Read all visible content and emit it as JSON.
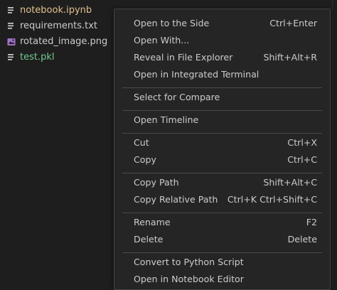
{
  "explorer": {
    "files": [
      {
        "name": "notebook.ipynb",
        "color": "#e2c08d",
        "icon": "notebook-icon",
        "icon_color": "#d4d4d4"
      },
      {
        "name": "requirements.txt",
        "color": "#cccccc",
        "icon": "text-file-icon",
        "icon_color": "#d4d4d4"
      },
      {
        "name": "rotated_image.png",
        "color": "#cccccc",
        "icon": "image-file-icon",
        "icon_color": "#a074c4"
      },
      {
        "name": "test.pkl",
        "color": "#73c991",
        "icon": "file-lines-icon",
        "icon_color": "#d4d4d4"
      }
    ]
  },
  "context_menu": {
    "groups": [
      [
        {
          "label": "Open to the Side",
          "shortcut": "Ctrl+Enter"
        },
        {
          "label": "Open With...",
          "shortcut": ""
        },
        {
          "label": "Reveal in File Explorer",
          "shortcut": "Shift+Alt+R"
        },
        {
          "label": "Open in Integrated Terminal",
          "shortcut": ""
        }
      ],
      [
        {
          "label": "Select for Compare",
          "shortcut": ""
        }
      ],
      [
        {
          "label": "Open Timeline",
          "shortcut": ""
        }
      ],
      [
        {
          "label": "Cut",
          "shortcut": "Ctrl+X"
        },
        {
          "label": "Copy",
          "shortcut": "Ctrl+C"
        }
      ],
      [
        {
          "label": "Copy Path",
          "shortcut": "Shift+Alt+C"
        },
        {
          "label": "Copy Relative Path",
          "shortcut": "Ctrl+K Ctrl+Shift+C"
        }
      ],
      [
        {
          "label": "Rename",
          "shortcut": "F2"
        },
        {
          "label": "Delete",
          "shortcut": "Delete"
        }
      ],
      [
        {
          "label": "Convert to Python Script",
          "shortcut": ""
        },
        {
          "label": "Open in Notebook Editor",
          "shortcut": ""
        }
      ]
    ]
  },
  "colors": {
    "background": "#1e1e1e",
    "menu_background": "#252526",
    "menu_text": "#cccccc",
    "separator": "#4a4a4a"
  }
}
